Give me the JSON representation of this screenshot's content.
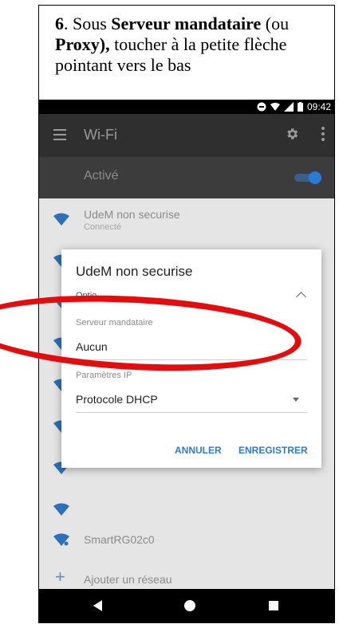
{
  "caption": {
    "step_number": "6",
    "text_1": ". Sous ",
    "bold_1": "Serveur mandataire",
    "text_2": " (ou ",
    "bold_2": "Proxy),",
    "text_3": " toucher à la petite flèche pointant vers le bas"
  },
  "status_bar": {
    "time": "09:42"
  },
  "app_bar": {
    "title": "Wi-Fi"
  },
  "wifi_toggle": {
    "label": "Activé",
    "on": true
  },
  "networks": [
    {
      "name": "UdeM non securise",
      "status": "Connecté"
    },
    {
      "name": "SmartRG02c0",
      "status": ""
    }
  ],
  "add_network": {
    "label": "Ajouter un réseau"
  },
  "dialog": {
    "title": "UdeM non securise",
    "options_label": "Optio",
    "proxy": {
      "label": "Serveur mandataire",
      "value": "Aucun"
    },
    "ip_settings": {
      "label": "Paramètres IP",
      "value": "Protocole DHCP"
    },
    "cancel": "ANNULER",
    "save": "ENREGISTRER"
  },
  "colors": {
    "accent": "#2d79d6",
    "highlight": "#e40d0d"
  }
}
